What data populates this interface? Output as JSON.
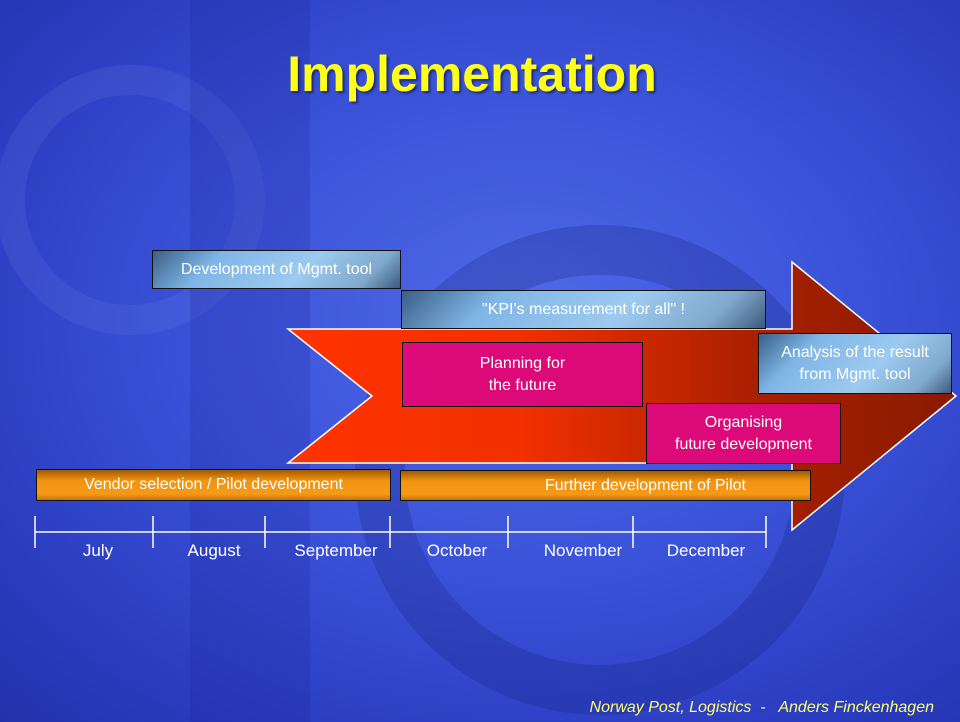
{
  "title": "Implementation",
  "bars": {
    "dev_mgmt_tool": "Development of Mgmt. tool",
    "kpi": "\"KPI's measurement for all\" !",
    "planning": [
      "Planning for",
      "the future"
    ],
    "analysis": [
      "Analysis of the result",
      "from Mgmt. tool"
    ],
    "organising": [
      "Organising",
      "future development"
    ],
    "vendor": "Vendor selection / Pilot development",
    "further": "Further development of Pilot"
  },
  "timeline": {
    "months": [
      "July",
      "August",
      "September",
      "October",
      "November",
      "December"
    ]
  },
  "footer": "Norway Post, Logistics  -   Anders Finckenhagen",
  "colors": {
    "title": "#ffff1a",
    "arrow_start": "#ff3300",
    "arrow_end": "#8a1a00",
    "pink": "#dc0a78",
    "orange": "#f29410"
  }
}
